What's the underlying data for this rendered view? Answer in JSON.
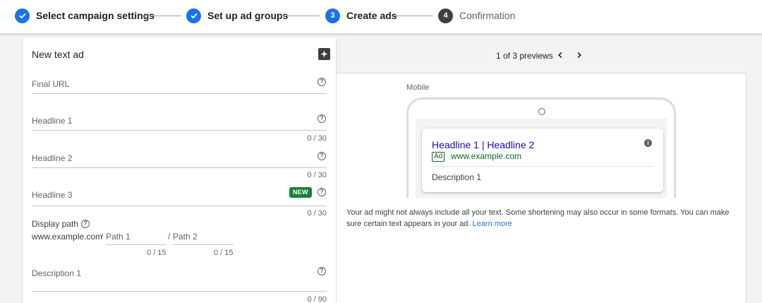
{
  "stepper": {
    "steps": [
      {
        "label": "Select campaign settings",
        "state": "done"
      },
      {
        "label": "Set up ad groups",
        "state": "done"
      },
      {
        "label": "Create ads",
        "state": "current",
        "number": "3"
      },
      {
        "label": "Confirmation",
        "state": "todo",
        "number": "4"
      }
    ]
  },
  "form": {
    "title": "New text ad",
    "final_url": {
      "label": "Final URL"
    },
    "headline1": {
      "label": "Headline 1",
      "counter": "0 / 30"
    },
    "headline2": {
      "label": "Headline 2",
      "counter": "0 / 30"
    },
    "headline3": {
      "label": "Headline 3",
      "counter": "0 / 30",
      "badge": "NEW"
    },
    "display_path": {
      "label": "Display path",
      "domain": "www.example.com",
      "separator": "/",
      "path1": {
        "placeholder": "Path 1",
        "counter": "0 / 15"
      },
      "path2": {
        "placeholder": "Path 2",
        "counter": "0 / 15"
      }
    },
    "description1": {
      "label": "Description 1",
      "counter": "0 / 90"
    }
  },
  "preview": {
    "count": "1 of 3 previews",
    "device_label": "Mobile",
    "ad": {
      "headline": "Headline 1 | Headline 2",
      "tag": "Ad",
      "url": "www.example.com",
      "description": "Description 1"
    },
    "disclaimer": "Your ad might not always include all your text. Some shortening may also occur in some formats. You can make sure certain text appears in your ad.",
    "learn_more": "Learn more"
  },
  "colors": {
    "accent": "#1a73e8",
    "ad_link": "#1a0dab",
    "ad_url": "#0d652d",
    "new_badge": "#188038"
  }
}
